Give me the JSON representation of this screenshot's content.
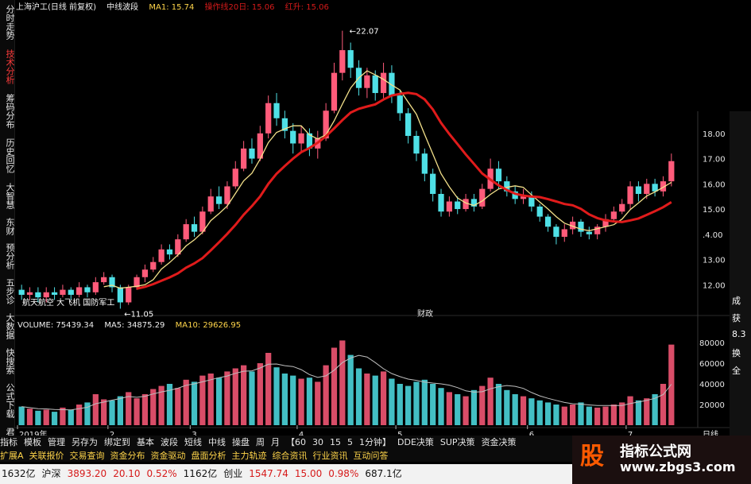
{
  "header": {
    "title": "上海沪工(日线 前复权)",
    "indicator_name": "中线波段",
    "ma1": "MA1: 15.74",
    "ma1_value": ": 15.74",
    "ma2": "操作线20日: 15.06",
    "ma3": "红升: 15.06"
  },
  "sidebar": {
    "tabs": [
      {
        "label": "分时走势",
        "active": false
      },
      {
        "label": "技术分析",
        "active": true
      },
      {
        "label": "筹码分布",
        "active": false
      },
      {
        "label": "历史回忆",
        "active": false
      },
      {
        "label": "大智慧",
        "active": false
      },
      {
        "label": "东财",
        "active": false
      },
      {
        "label": "预分析",
        "active": false
      },
      {
        "label": "五步诊",
        "active": false
      },
      {
        "label": "大数据",
        "active": false
      },
      {
        "label": "快搜索",
        "active": false
      },
      {
        "label": "公式下载",
        "active": false
      },
      {
        "label": "君资",
        "active": false
      }
    ]
  },
  "price_axis": {
    "labels": [
      "18.00",
      "17.00",
      "16.00",
      "15.00",
      ".4.00",
      "13.00",
      "12.00"
    ]
  },
  "price_annotations": {
    "high": "22.07",
    "low": "11.05",
    "concept": "航天航空 大飞机 国防军工",
    "event": "财政"
  },
  "volume_header": {
    "volume": "VOLUME: 75439.34",
    "ma5": "MA5: 34875.29",
    "ma10": "MA10: 29626.95"
  },
  "volume_axis": {
    "labels": [
      "80000",
      "60000",
      "40000",
      "20000"
    ]
  },
  "time_axis": {
    "labels": [
      "2019年",
      "2",
      "3",
      "4",
      "5",
      "6",
      "7"
    ],
    "right_label": "日线"
  },
  "toolbar1": [
    "指标",
    "模板",
    "管理",
    "另存为",
    "绑定到",
    "基本",
    "波段",
    "短线",
    "中线",
    "操盘",
    "周",
    "月",
    "【60",
    "30",
    "15",
    "5",
    "1分钟】",
    "DDE决策",
    "SUP决策",
    "资金决策"
  ],
  "toolbar2": [
    "扩展A",
    "关联报价",
    "交易查询",
    "资金分布",
    "资金驱动",
    "盘面分析",
    "主力轨迹",
    "综合资讯",
    "行业资讯",
    "互动问答"
  ],
  "statusbar": [
    {
      "text": "1632亿",
      "color": "#111111"
    },
    {
      "text": "沪深",
      "color": "#111111"
    },
    {
      "text": "3893.20",
      "color": "#d61a1a"
    },
    {
      "text": "20.10",
      "color": "#d61a1a"
    },
    {
      "text": "0.52%",
      "color": "#d61a1a"
    },
    {
      "text": "1162亿",
      "color": "#111111"
    },
    {
      "text": "创业",
      "color": "#111111"
    },
    {
      "text": "1547.74",
      "color": "#d61a1a"
    },
    {
      "text": "15.00",
      "color": "#d61a1a"
    },
    {
      "text": "0.98%",
      "color": "#d61a1a"
    },
    {
      "text": "687.1亿",
      "color": "#111111"
    }
  ],
  "right_edge": [
    "成",
    "获",
    "8.3",
    "换",
    "全"
  ],
  "watermark": {
    "logo": "股",
    "title": "指标公式网",
    "url": "www.zbgs3.com"
  },
  "colors": {
    "up": "#ff5b7a",
    "down": "#4fe0e6",
    "ma_red": "#e01b1b",
    "ma_yellow": "#f3e08a",
    "vol_ma": "#bfbfbf"
  },
  "chart_data": {
    "type": "candlestick",
    "title": "上海沪工(日线 前复权)",
    "ylim": [
      11.0,
      22.5
    ],
    "x": [
      "2019-01",
      "2019-02",
      "2019-03",
      "2019-04",
      "2019-05",
      "2019-06",
      "2019-07"
    ],
    "candles": [
      [
        11.8,
        11.6,
        12.0,
        11.4
      ],
      [
        11.6,
        11.7,
        11.9,
        11.4
      ],
      [
        11.7,
        11.5,
        11.9,
        11.3
      ],
      [
        11.5,
        11.7,
        11.9,
        11.3
      ],
      [
        11.7,
        11.6,
        11.9,
        11.4
      ],
      [
        11.6,
        11.8,
        12.0,
        11.5
      ],
      [
        11.8,
        11.6,
        11.9,
        11.4
      ],
      [
        11.6,
        11.9,
        12.1,
        11.5
      ],
      [
        11.9,
        11.7,
        12.0,
        11.5
      ],
      [
        11.7,
        12.1,
        12.3,
        11.6
      ],
      [
        12.1,
        12.3,
        12.5,
        12.0
      ],
      [
        12.3,
        11.9,
        12.4,
        11.7
      ],
      [
        11.9,
        11.3,
        12.0,
        11.05
      ],
      [
        11.3,
        11.9,
        12.0,
        11.2
      ],
      [
        11.9,
        12.3,
        12.4,
        11.8
      ],
      [
        12.3,
        12.6,
        12.8,
        12.1
      ],
      [
        12.6,
        12.9,
        13.1,
        12.5
      ],
      [
        12.9,
        13.4,
        13.6,
        12.8
      ],
      [
        13.4,
        13.2,
        13.6,
        13.0
      ],
      [
        13.2,
        13.8,
        14.0,
        13.1
      ],
      [
        13.8,
        14.4,
        14.6,
        13.7
      ],
      [
        14.4,
        14.1,
        14.7,
        13.9
      ],
      [
        14.1,
        14.9,
        15.1,
        14.0
      ],
      [
        14.9,
        15.5,
        15.8,
        14.8
      ],
      [
        15.5,
        15.2,
        15.9,
        15.0
      ],
      [
        15.2,
        15.9,
        16.1,
        15.0
      ],
      [
        15.9,
        16.6,
        16.9,
        15.8
      ],
      [
        16.6,
        17.4,
        17.7,
        16.5
      ],
      [
        17.4,
        17.0,
        17.8,
        16.8
      ],
      [
        17.0,
        18.0,
        18.3,
        16.9
      ],
      [
        18.0,
        19.2,
        19.5,
        17.8
      ],
      [
        19.2,
        18.6,
        19.6,
        18.3
      ],
      [
        18.6,
        18.1,
        18.9,
        17.8
      ],
      [
        18.1,
        17.6,
        18.4,
        17.2
      ],
      [
        17.6,
        18.0,
        18.3,
        17.3
      ],
      [
        18.0,
        17.4,
        18.2,
        17.1
      ],
      [
        17.4,
        17.8,
        18.1,
        17.0
      ],
      [
        17.8,
        18.9,
        19.2,
        17.7
      ],
      [
        18.9,
        20.4,
        20.8,
        18.8
      ],
      [
        20.4,
        21.3,
        22.07,
        20.1
      ],
      [
        21.3,
        20.6,
        21.6,
        20.2
      ],
      [
        20.6,
        19.8,
        20.9,
        19.5
      ],
      [
        19.8,
        20.3,
        20.6,
        19.4
      ],
      [
        20.3,
        19.6,
        20.5,
        19.3
      ],
      [
        19.6,
        20.4,
        20.8,
        19.4
      ],
      [
        20.4,
        19.5,
        20.7,
        19.2
      ],
      [
        19.5,
        18.8,
        19.7,
        18.5
      ],
      [
        18.8,
        17.9,
        19.0,
        17.6
      ],
      [
        17.9,
        17.2,
        18.1,
        16.9
      ],
      [
        17.2,
        16.4,
        17.4,
        16.1
      ],
      [
        16.4,
        15.6,
        16.6,
        15.3
      ],
      [
        15.6,
        14.9,
        15.8,
        14.7
      ],
      [
        14.9,
        15.3,
        15.5,
        14.7
      ],
      [
        15.3,
        15.0,
        15.5,
        14.8
      ],
      [
        15.0,
        15.4,
        15.6,
        14.9
      ],
      [
        15.4,
        15.1,
        15.6,
        14.9
      ],
      [
        15.1,
        15.8,
        16.0,
        15.0
      ],
      [
        15.8,
        16.6,
        17.0,
        15.7
      ],
      [
        16.6,
        16.1,
        16.9,
        15.8
      ],
      [
        16.1,
        15.7,
        16.3,
        15.5
      ],
      [
        15.7,
        15.4,
        15.9,
        15.2
      ],
      [
        15.4,
        15.5,
        15.8,
        15.2
      ],
      [
        15.5,
        15.1,
        15.7,
        14.9
      ],
      [
        15.1,
        14.7,
        15.2,
        14.5
      ],
      [
        14.7,
        14.3,
        14.8,
        14.1
      ],
      [
        14.3,
        13.9,
        14.4,
        13.6
      ],
      [
        13.9,
        14.2,
        14.4,
        13.7
      ],
      [
        14.2,
        14.5,
        14.7,
        14.0
      ],
      [
        14.5,
        14.1,
        14.6,
        13.9
      ],
      [
        14.1,
        14.0,
        14.3,
        13.8
      ],
      [
        14.0,
        14.3,
        14.4,
        13.8
      ],
      [
        14.3,
        14.6,
        14.8,
        14.1
      ],
      [
        14.6,
        14.9,
        15.1,
        14.5
      ],
      [
        14.9,
        15.2,
        15.4,
        14.8
      ],
      [
        15.2,
        15.9,
        16.1,
        15.0
      ],
      [
        15.9,
        15.6,
        16.1,
        15.3
      ],
      [
        15.6,
        16.0,
        16.2,
        15.4
      ],
      [
        16.0,
        15.7,
        16.2,
        15.5
      ],
      [
        15.7,
        16.1,
        16.3,
        15.5
      ],
      [
        16.1,
        16.9,
        17.2,
        15.9
      ]
    ],
    "volume": [
      18,
      16,
      14,
      15,
      13,
      17,
      15,
      20,
      22,
      30,
      25,
      24,
      28,
      32,
      26,
      30,
      35,
      38,
      40,
      36,
      44,
      42,
      48,
      50,
      46,
      52,
      55,
      58,
      52,
      60,
      70,
      56,
      50,
      48,
      45,
      46,
      42,
      58,
      75,
      82,
      68,
      55,
      50,
      48,
      52,
      45,
      40,
      38,
      42,
      44,
      40,
      36,
      32,
      30,
      28,
      34,
      38,
      46,
      40,
      34,
      30,
      28,
      26,
      24,
      22,
      20,
      18,
      20,
      22,
      18,
      17,
      18,
      20,
      22,
      28,
      24,
      26,
      30,
      40,
      78
    ]
  }
}
